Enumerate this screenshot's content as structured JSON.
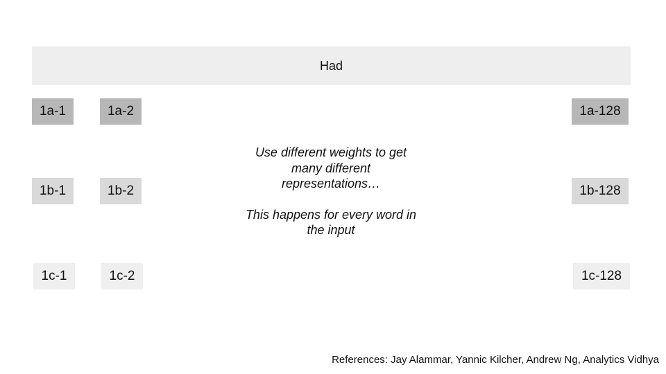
{
  "diagram": {
    "word": "Had",
    "rows": [
      {
        "id": "a",
        "labels": [
          "1a-1",
          "1a-2",
          "1a-128"
        ]
      },
      {
        "id": "b",
        "labels": [
          "1b-1",
          "1b-2",
          "1b-128"
        ]
      },
      {
        "id": "c",
        "labels": [
          "1c-1",
          "1c-2",
          "1c-128"
        ]
      }
    ],
    "note": {
      "line1": "Use different weights to get many different representations…",
      "line2": "This happens for every word in the input"
    },
    "references": "References: Jay Alammar, Yannic Kilcher, Andrew Ng, Analytics Vidhya"
  }
}
